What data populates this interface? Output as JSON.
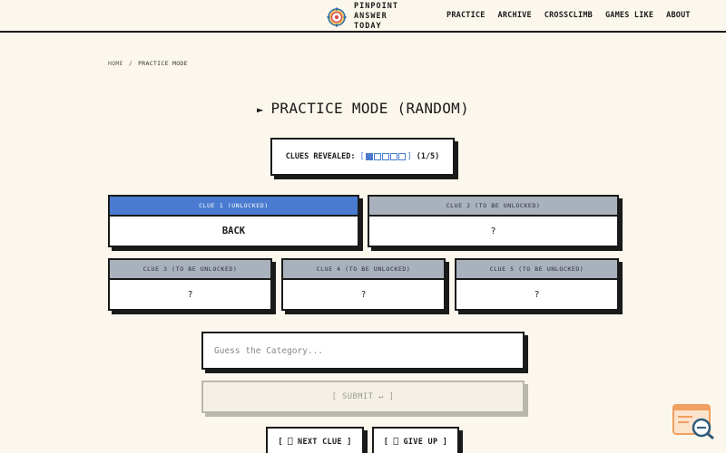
{
  "header": {
    "logo_text": "PINPOINT\nANSWER\nTODAY",
    "nav": [
      "PRACTICE",
      "ARCHIVE",
      "CROSSCLIMB",
      "GAMES LIKE",
      "ABOUT"
    ]
  },
  "breadcrumb": {
    "home": "HOME",
    "sep": "/",
    "current": "PRACTICE MODE"
  },
  "title": {
    "arrow": "►",
    "text": "PRACTICE MODE (RANDOM)"
  },
  "revealed": {
    "label": "CLUES REVEALED:",
    "open": "[",
    "close": "]",
    "count": "(1/5)",
    "revealed": 1,
    "total": 5
  },
  "clues": [
    {
      "header": "CLUE 1 (UNLOCKED)",
      "value": "BACK"
    },
    {
      "header": "CLUE 2 (TO BE UNLOCKED)",
      "value": "?"
    },
    {
      "header": "CLUE 3 (TO BE UNLOCKED)",
      "value": "?"
    },
    {
      "header": "CLUE 4 (TO BE UNLOCKED)",
      "value": "?"
    },
    {
      "header": "CLUE 5 (TO BE UNLOCKED)",
      "value": "?"
    }
  ],
  "guess": {
    "placeholder": "Guess the Category..."
  },
  "submit": {
    "label": "[ SUBMIT ↵ ]"
  },
  "actions": {
    "next_clue": "[ ⎕ NEXT CLUE ]",
    "give_up": "[ ⎕ GIVE UP ]"
  },
  "colors": {
    "accent": "#4a7bd0",
    "locked": "#a9b1bd",
    "background": "#fbf7ec",
    "fab": "#f0a060"
  },
  "icons": {
    "logo": "compass-logo-icon",
    "fab": "search-help-icon"
  }
}
